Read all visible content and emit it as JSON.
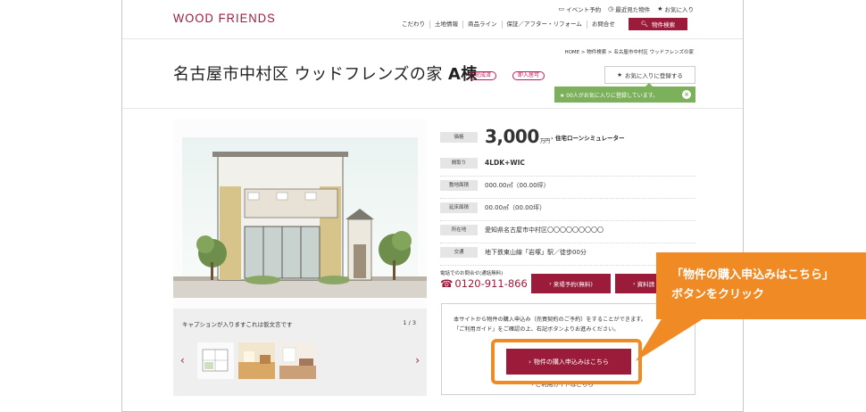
{
  "header": {
    "logo": "WOOD FRIENDS",
    "util_links": [
      {
        "icon": "monitor-icon",
        "glyph": "▭",
        "label": "イベント予約"
      },
      {
        "icon": "clock-icon",
        "glyph": "◷",
        "label": "最近見た物件"
      },
      {
        "icon": "star-icon",
        "glyph": "★",
        "label": "お気に入り"
      }
    ],
    "nav": [
      "こだわり",
      "土地情報",
      "商品ライン",
      "保証／アフター・リフォーム",
      "お問合せ"
    ],
    "search_button": "物件検索"
  },
  "breadcrumb": "HOME > 物件検索 > 名古屋市中村区 ウッドフレンズの家",
  "property": {
    "title": "名古屋市中村区 ウッドフレンズの家",
    "building": "A棟",
    "badges": [
      "完成済",
      "即入居可"
    ]
  },
  "favorite": {
    "button": "お気に入りに登録する",
    "note": "★ 00人がお気に入りに登録しています。"
  },
  "gallery": {
    "caption": "キャプションが入りますこれは仮文言です",
    "counter": "1 / 3"
  },
  "spec": {
    "price_label": "価格",
    "price": "3,000",
    "price_unit": "万円",
    "loan_link": "住宅ローンシミュレーター",
    "madori_label": "間取り",
    "madori": "4LDK+WIC",
    "land_label": "敷地面積",
    "land": "000.00㎡（00.00坪）",
    "floor_label": "延床面積",
    "floor": "00.00㎡（00.00坪）",
    "address_label": "所在地",
    "address": "愛知県名古屋市中村区〇〇〇〇〇〇〇〇〇",
    "access_label": "交通",
    "access": "地下鉄東山線「岩塚」駅／徒歩00分"
  },
  "contact": {
    "small": "電話でのお問合せ(通話無料)",
    "tel": "0120-911-866",
    "visit_button": "来場予約(無料)",
    "doc_button": "資料請"
  },
  "purchase": {
    "line1": "本サイトから物件の購入申込み（売買契約のご予約）をすることができます。",
    "line2": "「ご利用ガイド」をご確認の上、右記ボタンよりお進みください。",
    "button": "物件の購入申込みはこちら",
    "guide": "ご利用ガイドはこちら"
  },
  "annotation": {
    "line1": "「物件の購入申込みはこちら」",
    "line2": "ボタンをクリック"
  },
  "colors": {
    "brand": "#9a1b3a",
    "accent": "#f08a24",
    "fav_green": "#7cb05a"
  }
}
